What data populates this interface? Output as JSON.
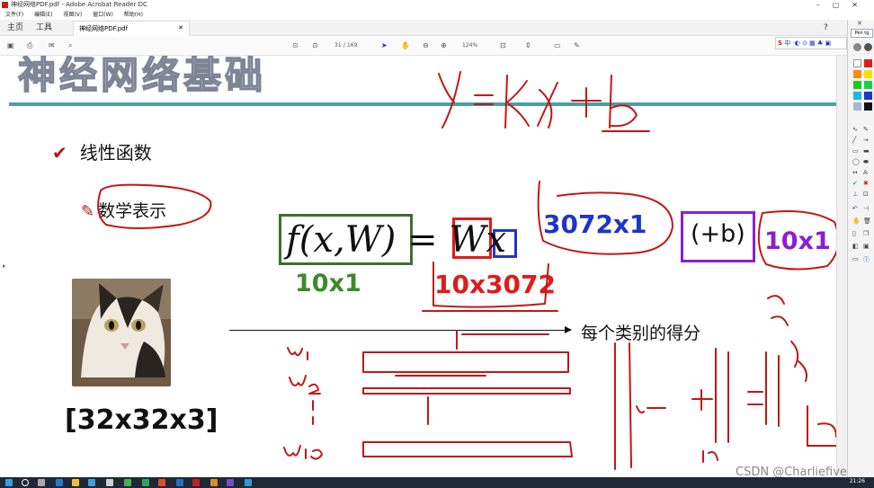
{
  "window": {
    "title": "神经网络PDF.pdf - Adobe Acrobat Reader DC"
  },
  "menu": [
    "文件(F)",
    "编辑(E)",
    "视图(V)",
    "窗口(W)",
    "帮助(H)"
  ],
  "tabs": {
    "home": "主页",
    "tools": "工具",
    "document": "神经网络PDF.pdf"
  },
  "toolbar": {
    "page_current": "31",
    "page_total": "/ 169",
    "zoom": "124%"
  },
  "ime": {
    "label": "中"
  },
  "pen_panel": {
    "title": "Pen tg"
  },
  "slide": {
    "title": "神经网络基础",
    "bullet1": "线性函数",
    "bullet2": "数学表示",
    "formula": "f(x,W) = Wx",
    "label_10x1_green": "10x1",
    "label_10x3072": "10x3072",
    "label_3072x1": "3072x1",
    "label_plus_b": "(+b)",
    "label_10x1_purple": "10x1",
    "dimension": "[32x32x3]",
    "score_label": "每个类别的得分"
  },
  "taskbar": {
    "clock": "21:26"
  },
  "watermark": "CSDN @Charliefive",
  "colors": {
    "green": "#3d6e2e",
    "red": "#e01b1b",
    "blue": "#1e35c8",
    "purple": "#8b1ed4",
    "teal": "#4a9fa3",
    "ink": "#c01818"
  }
}
